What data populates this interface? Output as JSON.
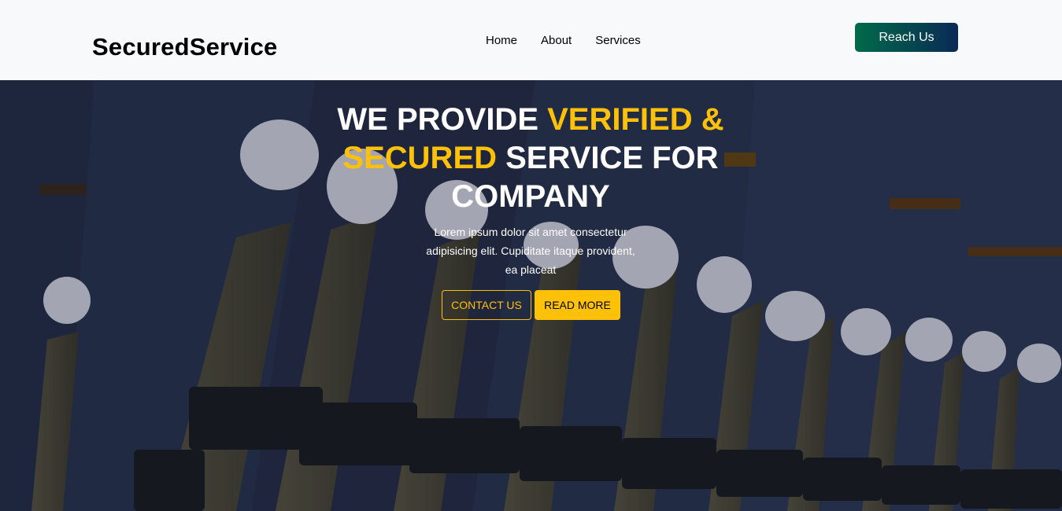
{
  "header": {
    "brand": "SecuredService",
    "nav": [
      {
        "label": "Home"
      },
      {
        "label": "About"
      },
      {
        "label": "Services"
      }
    ],
    "cta_label": "Reach Us"
  },
  "hero": {
    "title_part1": "WE PROVIDE ",
    "title_highlight": "VERIFIED & SECURED",
    "title_part2": " SERVICE FOR COMPANY",
    "text": "Lorem ipsum dolor sit amet consectetur adipisicing elit. Cupiditate itaque provident, ea placeat",
    "contact_label": "CONTACT US",
    "read_more_label": "READ MORE",
    "background_image": "ceremonial-guard-rifles-photo"
  },
  "colors": {
    "accent": "#ffc107",
    "nav_bg": "#f8f9fb",
    "cta_gradient_start": "#016a4a",
    "cta_gradient_end": "#0a2a55"
  }
}
